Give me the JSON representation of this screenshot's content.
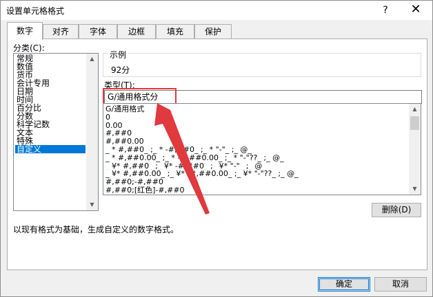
{
  "window": {
    "title": "设置单元格格式",
    "help": "?",
    "close": "✕"
  },
  "tabs": [
    {
      "label": "数字",
      "active": true
    },
    {
      "label": "对齐",
      "active": false
    },
    {
      "label": "字体",
      "active": false
    },
    {
      "label": "边框",
      "active": false
    },
    {
      "label": "填充",
      "active": false
    },
    {
      "label": "保护",
      "active": false
    }
  ],
  "category": {
    "label": "分类(C):",
    "items": [
      "常规",
      "数值",
      "货币",
      "会计专用",
      "日期",
      "时间",
      "百分比",
      "分数",
      "科学记数",
      "文本",
      "特殊",
      "自定义"
    ],
    "selected": "自定义"
  },
  "sample": {
    "label": "示例",
    "value": "92分"
  },
  "type": {
    "label": "类型(T):",
    "value": "G/通用格式分",
    "formats": [
      "G/通用格式",
      "0",
      "0.00",
      "#,##0",
      "#,##0.00",
      "_ * #,##0_ ;_ * -#,##0_ ;_ * \"-\"_ ;_ @_",
      "_ * #,##0.00_ ;_ * -#,##0.00_ ;_ * \"-\"??_ ;_ @_",
      "_ ¥* #,##0_ ;_ ¥* -#,##0_ ;_ ¥* \"-\"_ ;_ @_",
      "_ ¥* #,##0.00_ ;_ ¥* -#,##0.00_ ;_ ¥* \"-\"??_ ;_ @_",
      "#,##0;-#,##0",
      "#,##0;[红色]-#,##0"
    ]
  },
  "buttons": {
    "delete": "删除(D)",
    "ok": "确定",
    "cancel": "取消"
  },
  "description": "以现有格式为基础，生成自定义的数字格式。",
  "annotation_color": "#e0393e",
  "accent_color": "#0078d7"
}
